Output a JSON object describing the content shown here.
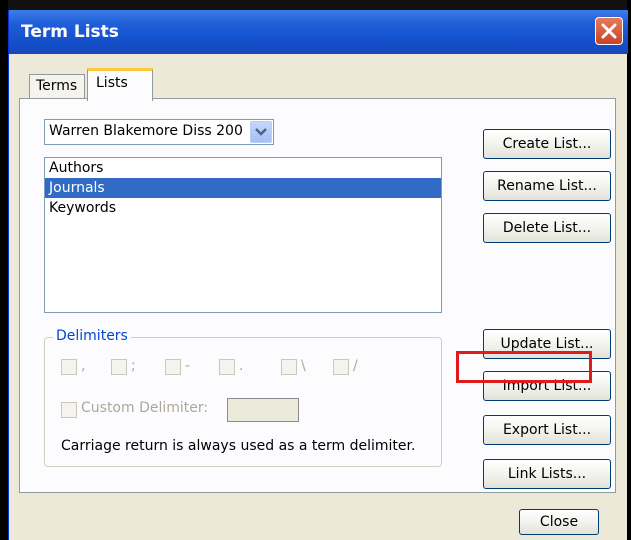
{
  "window": {
    "title": "Term Lists",
    "close_icon": "close-icon"
  },
  "tabs": [
    {
      "label": "Terms",
      "selected": false
    },
    {
      "label": "Lists",
      "selected": true
    }
  ],
  "library_select": {
    "value": "Warren Blakemore Diss 200"
  },
  "term_lists": {
    "items": [
      {
        "label": "Authors",
        "selected": false
      },
      {
        "label": "Journals",
        "selected": true
      },
      {
        "label": "Keywords",
        "selected": false
      }
    ]
  },
  "delimiters": {
    "legend": "Delimiters",
    "options": [
      {
        "label": ",",
        "checked": false
      },
      {
        "label": ";",
        "checked": false
      },
      {
        "label": "-",
        "checked": false
      },
      {
        "label": ".",
        "checked": false
      },
      {
        "label": "\\",
        "checked": false
      },
      {
        "label": "/",
        "checked": false
      }
    ],
    "custom_label": "Custom Delimiter:",
    "custom_value": "",
    "note": "Carriage return is always used as a term delimiter."
  },
  "buttons": {
    "create": "Create List...",
    "rename": "Rename List...",
    "delete": "Delete List...",
    "update": "Update List...",
    "import": "Import List...",
    "export": "Export List...",
    "link": "Link Lists...",
    "close": "Close"
  },
  "highlighted_button": "import",
  "colors": {
    "title_bar": "#1550cc",
    "selection": "#316ac5",
    "highlight_box": "#e21a1a",
    "legend_text": "#0046d5",
    "tab_accent": "#ffc83c"
  }
}
